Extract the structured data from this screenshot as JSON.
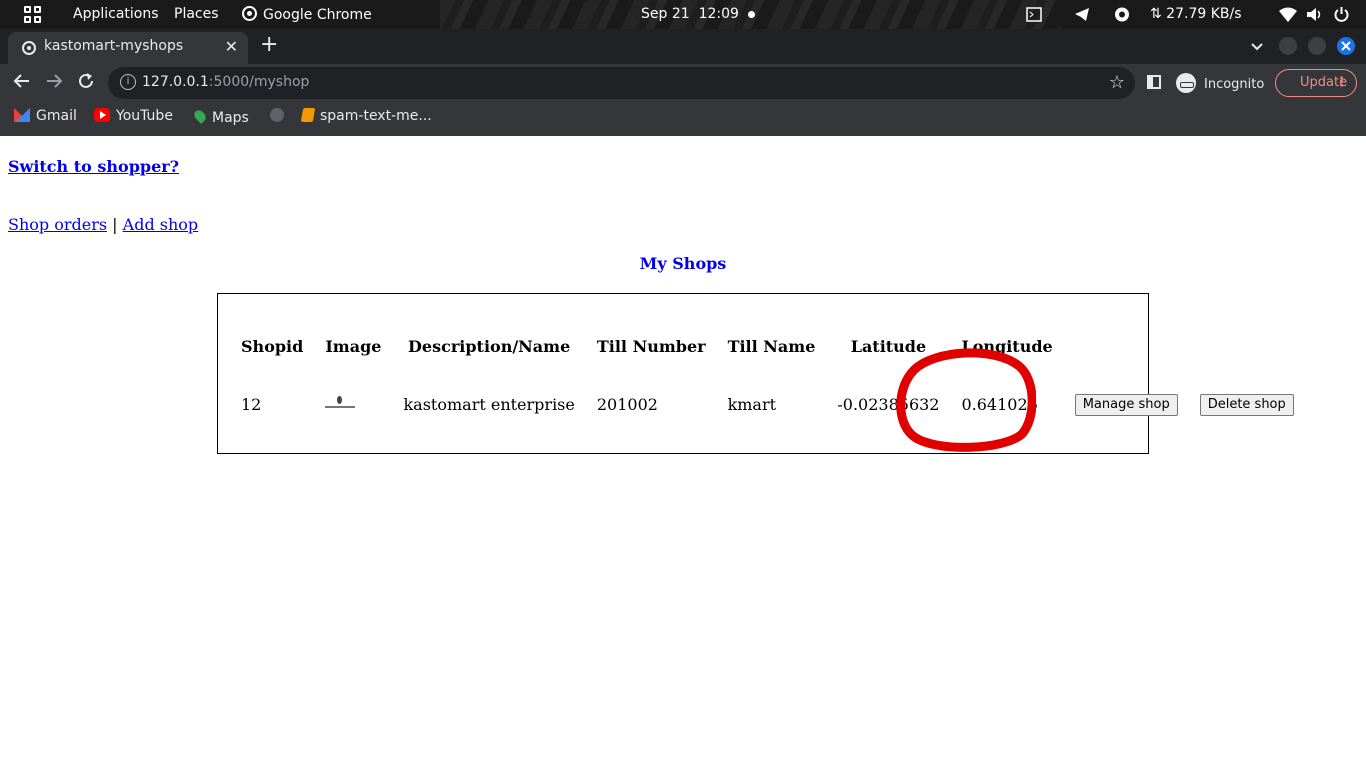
{
  "system_bar": {
    "applications": "Applications",
    "places": "Places",
    "active_app": "Google Chrome",
    "date": "Sep 21",
    "time": "12:09",
    "network_speed": "⇅ 27.79 KB/s"
  },
  "browser": {
    "tab_title": "kastomart-myshops",
    "url_host": "127.0.0.1",
    "url_path": ":5000/myshop",
    "incognito_label": "Incognito",
    "update_label": "Update",
    "bookmarks": [
      {
        "label": "Gmail",
        "icon": "gmail-icon"
      },
      {
        "label": "YouTube",
        "icon": "youtube-icon"
      },
      {
        "label": "Maps",
        "icon": "maps-icon"
      },
      {
        "label": "",
        "icon": "globe-icon"
      },
      {
        "label": "spam-text-me...",
        "icon": "bookmark-icon"
      }
    ]
  },
  "page": {
    "switch_link": "Switch to shopper?",
    "nav": {
      "shop_orders": "Shop orders",
      "separator": " | ",
      "add_shop": "Add shop"
    },
    "heading": "My Shops",
    "table": {
      "headers": [
        "Shopid",
        "Image",
        "Description/Name",
        "Till Number",
        "Till Name",
        "Latitude",
        "Longitude"
      ],
      "rows": [
        {
          "shopid": "12",
          "image_alt": "kastomart",
          "description": "kastomart enterprise",
          "till_number": "201002",
          "till_name": "kmart",
          "latitude": "-0.02385632",
          "longitude": "0.641026",
          "manage_label": "Manage shop",
          "delete_label": "Delete shop"
        }
      ]
    },
    "annotation_color": "#e00000"
  }
}
